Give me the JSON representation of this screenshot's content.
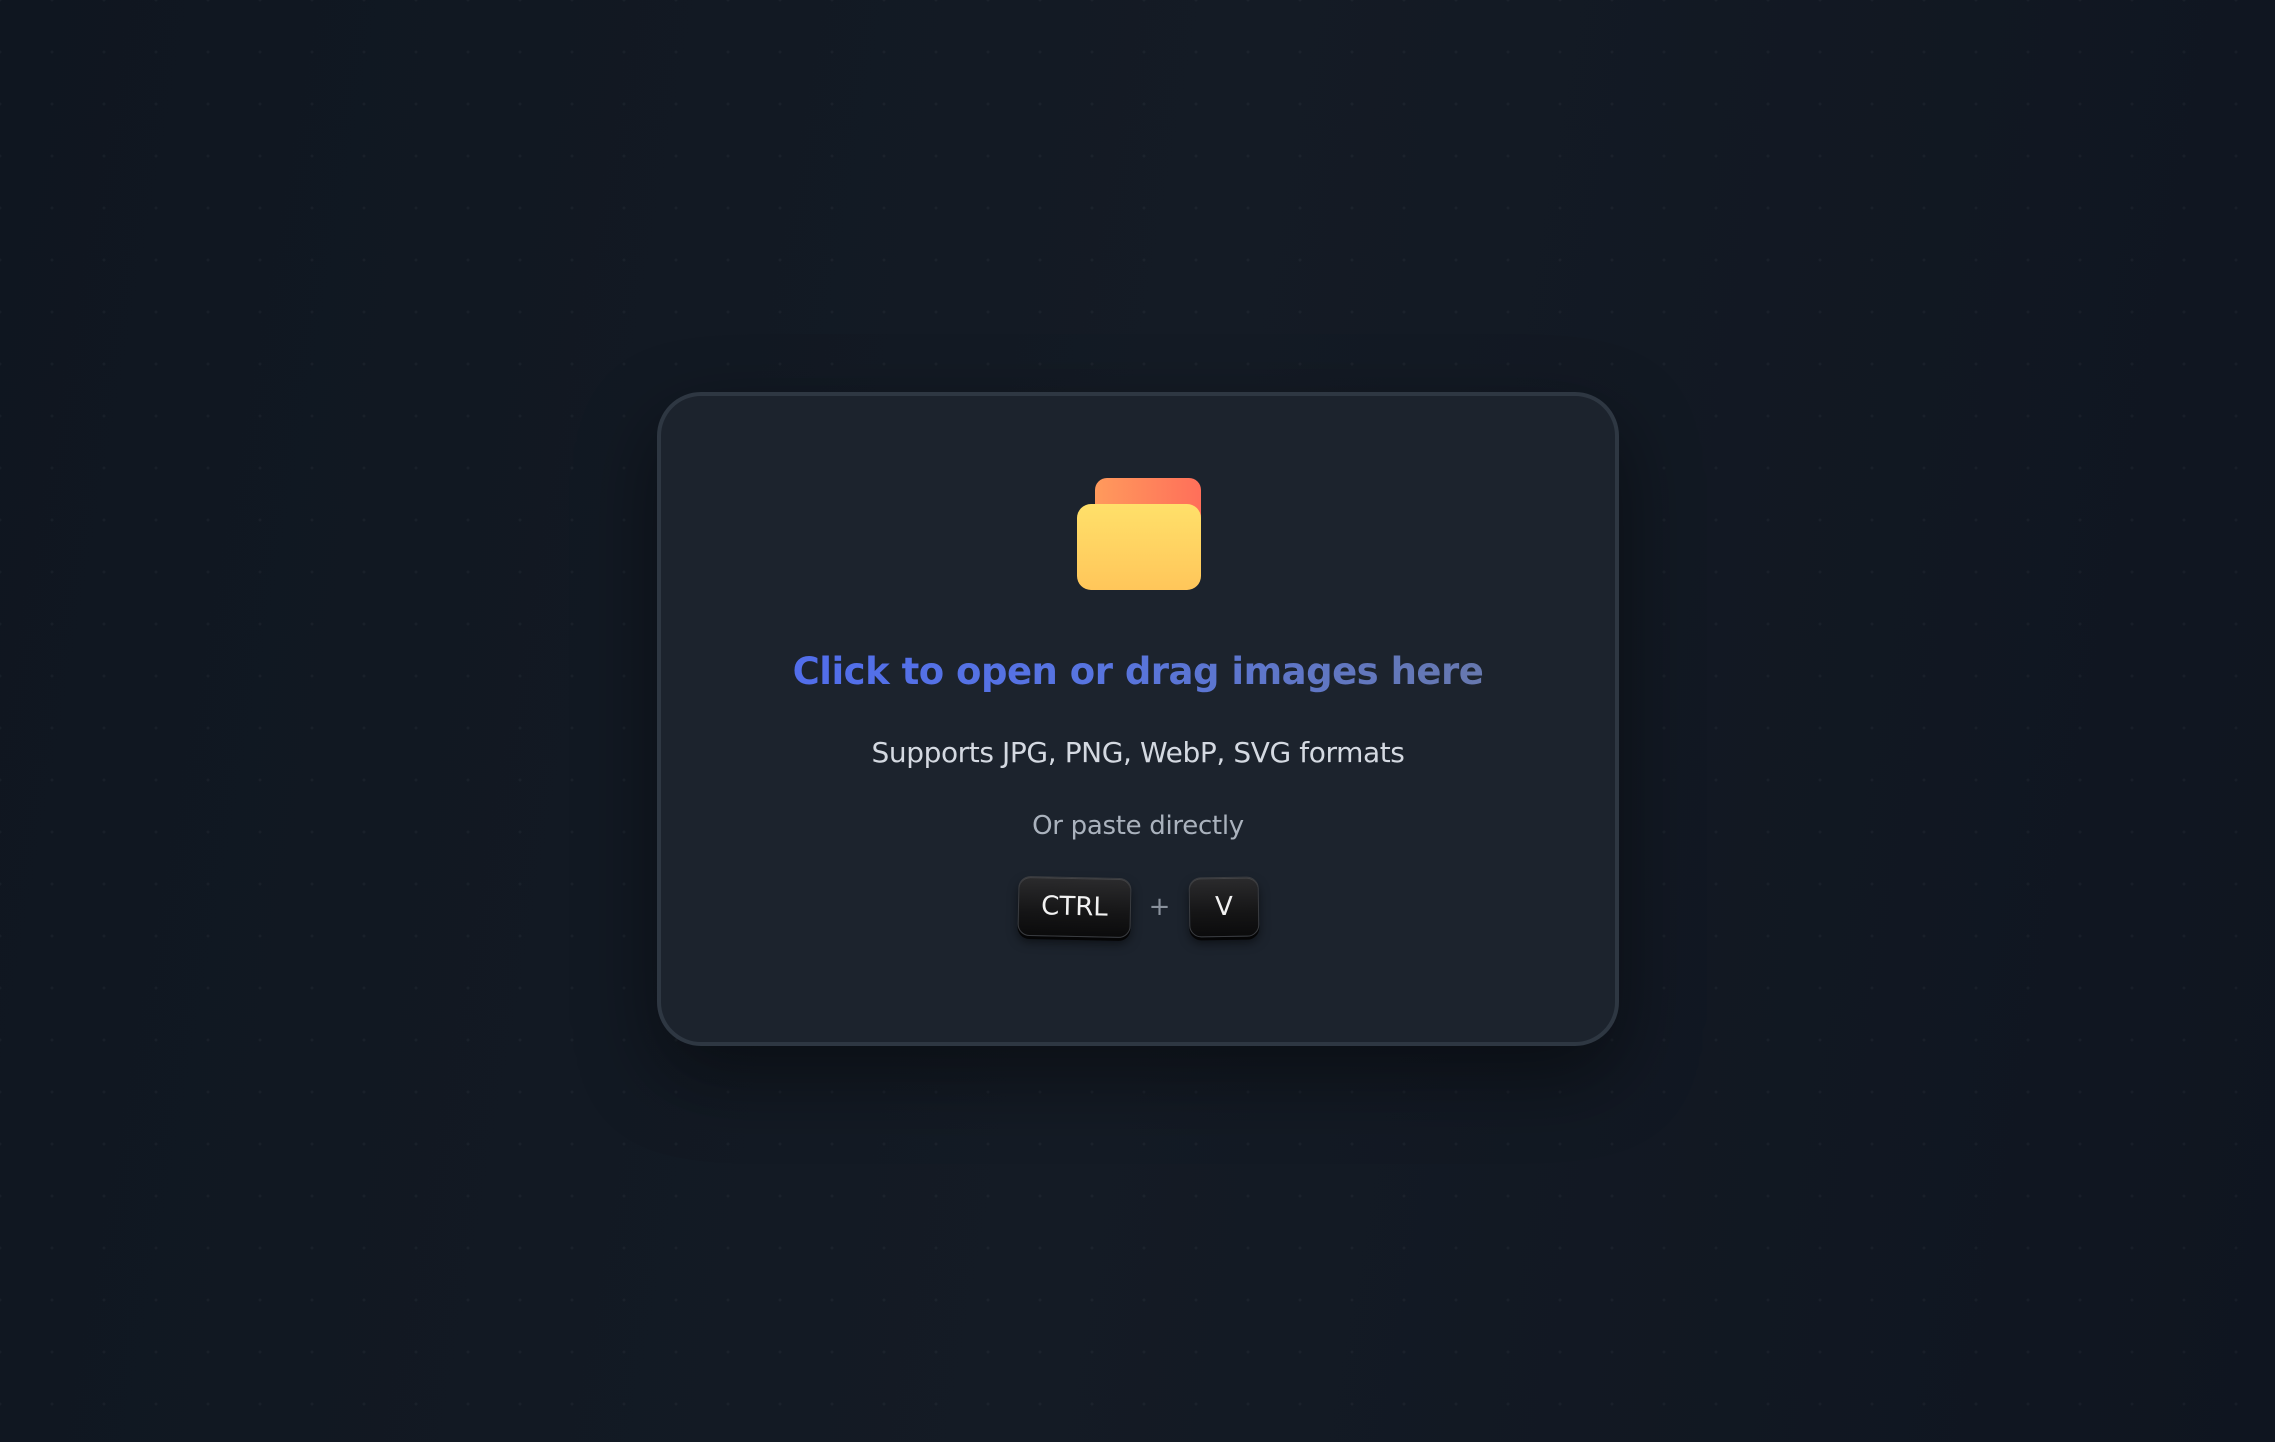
{
  "dropzone": {
    "icon": "folder-icon",
    "headline": "Click to open or drag images here",
    "formats": "Supports JPG, PNG, WebP, SVG formats",
    "paste_hint": "Or paste directly",
    "shortcut": {
      "key1": "CTRL",
      "separator": "+",
      "key2": "V"
    }
  },
  "colors": {
    "background": "#101722",
    "card": "#1c232d",
    "card_border": "#2e3742",
    "headline_start": "#4f6bf0",
    "headline_end": "#6c7a9e",
    "folder_front": "#ffd25e",
    "folder_back": "#ff7a5a"
  }
}
